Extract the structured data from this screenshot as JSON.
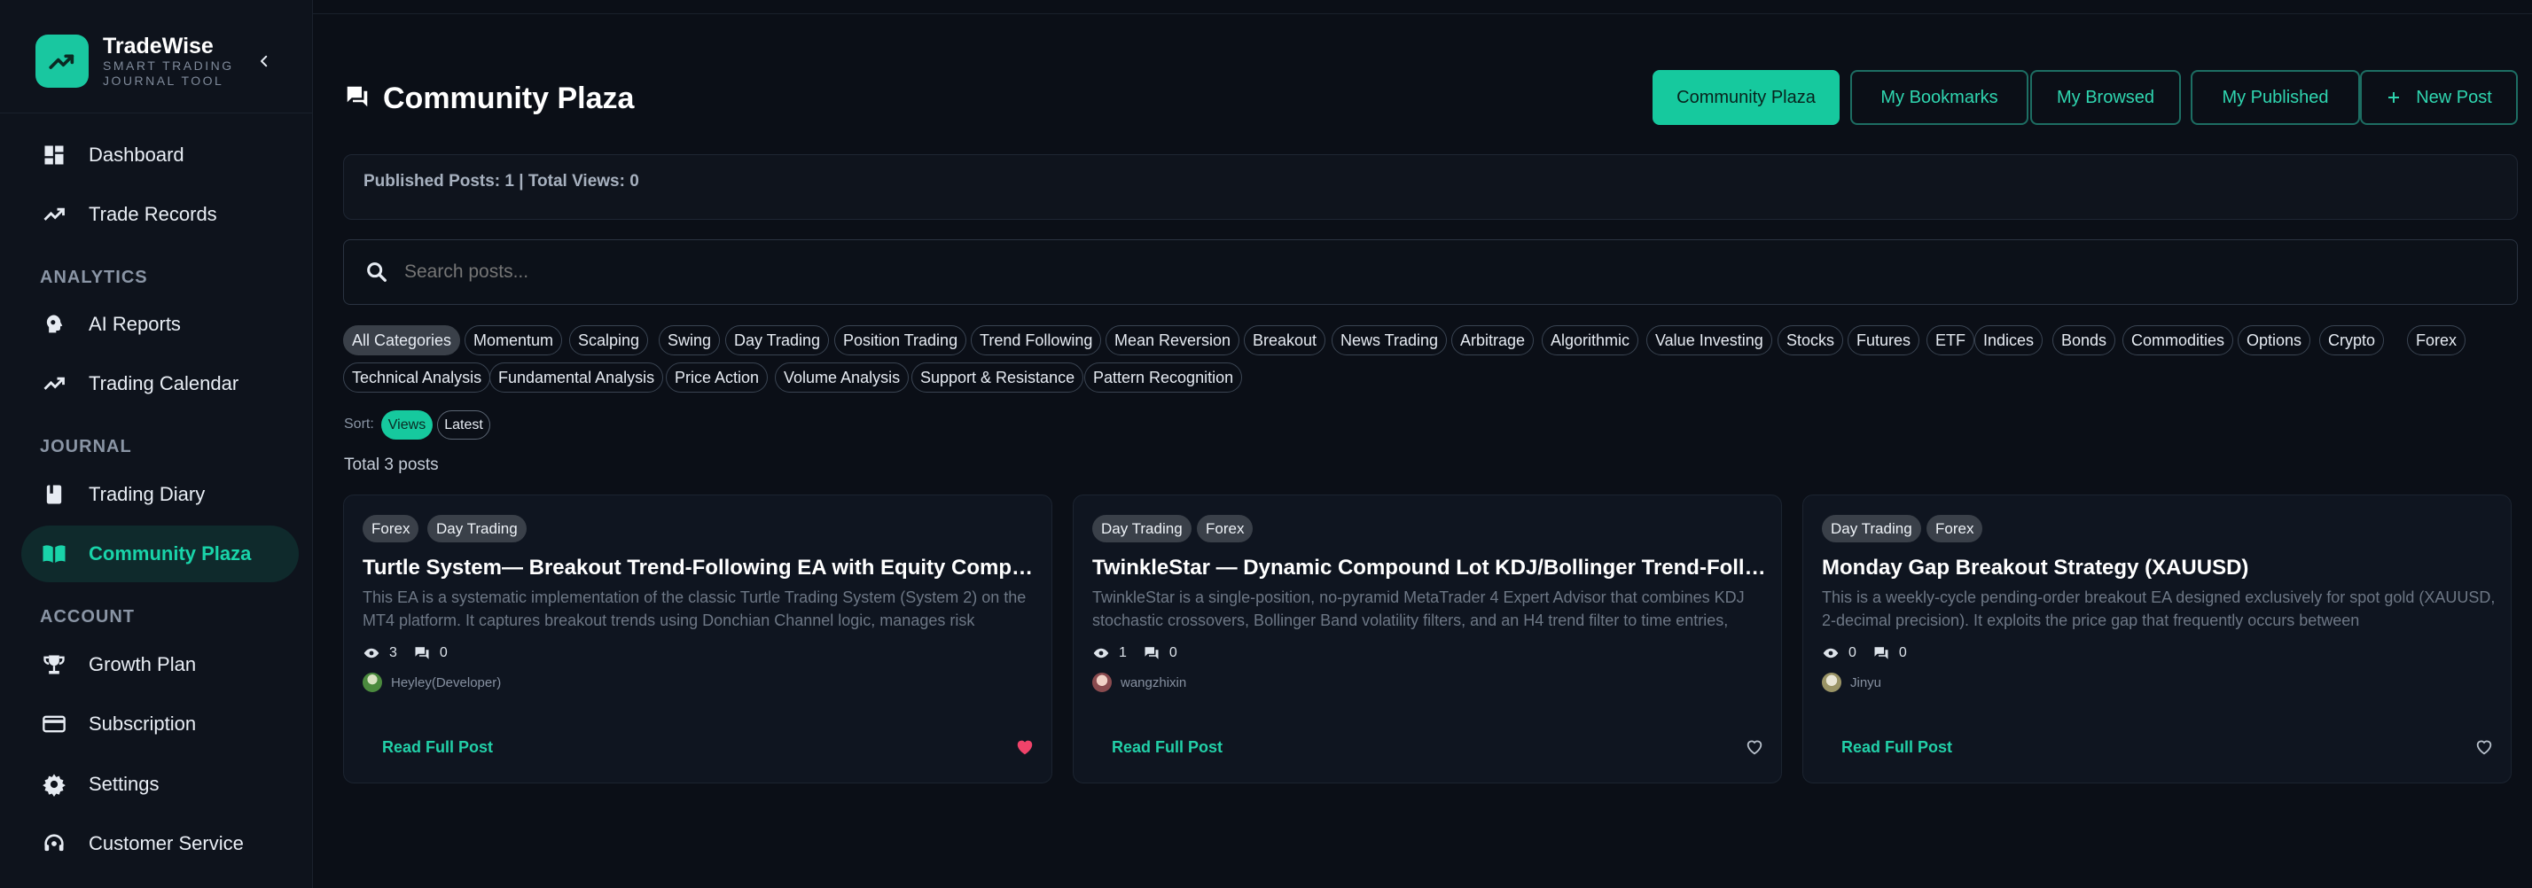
{
  "brand": {
    "name": "TradeWise",
    "subtitle": "SMART TRADING JOURNAL TOOL"
  },
  "sidebar": {
    "items": [
      {
        "label": "Dashboard",
        "icon": "dashboard-icon"
      },
      {
        "label": "Trade Records",
        "icon": "trend-icon"
      },
      {
        "label": "AI Reports",
        "icon": "ai-brain-icon"
      },
      {
        "label": "Trading Calendar",
        "icon": "trend-icon"
      },
      {
        "label": "Trading Diary",
        "icon": "book-icon"
      },
      {
        "label": "Community Plaza",
        "icon": "open-book-icon",
        "active": true
      },
      {
        "label": "Growth Plan",
        "icon": "trophy-icon"
      },
      {
        "label": "Subscription",
        "icon": "credit-card-icon"
      },
      {
        "label": "Settings",
        "icon": "gear-icon"
      },
      {
        "label": "Customer Service",
        "icon": "headset-icon"
      }
    ],
    "sections": {
      "analytics": "ANALYTICS",
      "journal": "JOURNAL",
      "account": "ACCOUNT"
    }
  },
  "header": {
    "title": "Community Plaza",
    "tabs": [
      "Community Plaza",
      "My Bookmarks",
      "My Browsed",
      "My Published"
    ],
    "new_post": "New Post"
  },
  "stats": {
    "text": "Published Posts: 1 | Total Views: 0"
  },
  "search": {
    "placeholder": "Search posts..."
  },
  "categories": [
    "All Categories",
    "Momentum",
    "Scalping",
    "Swing",
    "Day Trading",
    "Position Trading",
    "Trend Following",
    "Mean Reversion",
    "Breakout",
    "News Trading",
    "Arbitrage",
    "Algorithmic",
    "Value Investing",
    "Stocks",
    "Futures",
    "ETF",
    "Indices",
    "Bonds",
    "Commodities",
    "Options",
    "Crypto",
    "Forex",
    "Technical Analysis",
    "Fundamental Analysis",
    "Price Action",
    "Volume Analysis",
    "Support & Resistance",
    "Pattern Recognition"
  ],
  "sort": {
    "label": "Sort:",
    "options": [
      "Views",
      "Latest"
    ]
  },
  "total_posts": "Total 3 posts",
  "posts": [
    {
      "tags": [
        "Forex",
        "Day Trading"
      ],
      "title": "Turtle System— Breakout Trend-Following EA with Equity Compounding",
      "excerpt": "This EA is a systematic implementation of the classic Turtle Trading System (System 2) on the MT4 platform. It captures breakout trends using Donchian Channel logic, manages risk",
      "views": "3",
      "comments": "0",
      "author": "Heyley(Developer)",
      "read": "Read Full Post",
      "liked": true
    },
    {
      "tags": [
        "Day Trading",
        "Forex"
      ],
      "title": "TwinkleStar — Dynamic Compound Lot KDJ/Bollinger Trend-Following EA",
      "excerpt": "TwinkleStar is a single-position, no-pyramid MetaTrader 4 Expert Advisor that combines KDJ stochastic crossovers, Bollinger Band volatility filters, and an H4 trend filter to time entries,",
      "views": "1",
      "comments": "0",
      "author": "wangzhixin",
      "read": "Read Full Post",
      "liked": false
    },
    {
      "tags": [
        "Day Trading",
        "Forex"
      ],
      "title": "Monday Gap Breakout Strategy (XAUUSD)",
      "excerpt": "This is a weekly-cycle pending-order breakout EA designed exclusively for spot gold (XAUUSD, 2-decimal precision). It exploits the price gap that frequently occurs between",
      "views": "0",
      "comments": "0",
      "author": "Jinyu",
      "read": "Read Full Post",
      "liked": false
    }
  ],
  "colors": {
    "accent": "#16c99e",
    "background": "#0b0f17",
    "heart_liked": "#f0436a"
  }
}
